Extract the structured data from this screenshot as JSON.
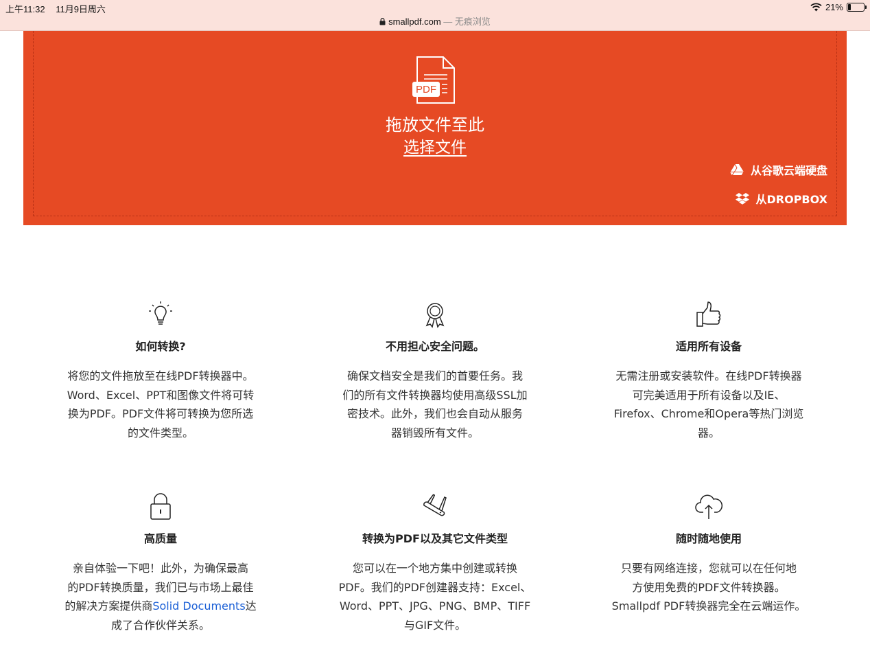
{
  "status_bar": {
    "time": "上午11:32",
    "date": "11月9日周六",
    "battery": "21%",
    "battery_level": 0.21
  },
  "url_bar": {
    "domain": "smallpdf.com",
    "separator": "—",
    "mode": "无痕浏览"
  },
  "dropzone": {
    "icon_label": "PDF",
    "drop_text": "拖放文件至此",
    "choose_label": "选择文件",
    "gdrive_label": "从谷歌云端硬盘",
    "dropbox_label": "从DROPBOX",
    "background_color": "#e64a24"
  },
  "features": [
    {
      "title": "如何转换?",
      "icon": "lightbulb-icon",
      "lines": [
        "将您的文件拖放至在线PDF转换器中。",
        "Word、Excel、PPT和图像文件将可转",
        "换为PDF。PDF文件将可转换为您所选",
        "的文件类型。"
      ]
    },
    {
      "title": "不用担心安全问题。",
      "icon": "award-icon",
      "lines": [
        "确保文档安全是我们的首要任务。我",
        "们的所有文件转换器均使用高级SSL加",
        "密技术。此外，我们也会自动从服务",
        "器销毁所有文件。"
      ]
    },
    {
      "title": "适用所有设备",
      "icon": "thumbs-up-icon",
      "lines": [
        "无需注册或安装软件。在线PDF转换器",
        "可完美适用于所有设备以及IE、",
        "Firefox、Chrome和Opera等热门浏览",
        "器。"
      ]
    },
    {
      "title": "高质量",
      "icon": "lock-icon",
      "line1": "亲自体验一下吧！此外，为确保最高",
      "line2": "的PDF转换质量，我们已与市场上最佳",
      "line3_prefix": "的解决方案提供商",
      "line3_link": "Solid Documents",
      "line3_suffix": "达",
      "line4": "成了合作伙伴关系。",
      "link_color": "#1a5fd6"
    },
    {
      "title": "转换为PDF以及其它文件类型",
      "icon": "swiss-knife-icon",
      "lines": [
        "您可以在一个地方集中创建或转换",
        "PDF。我们的PDF创建器支持：Excel、",
        "Word、PPT、JPG、PNG、BMP、TIFF",
        "与GIF文件。"
      ]
    },
    {
      "title": "随时随地使用",
      "icon": "cloud-upload-icon",
      "lines": [
        "只要有网络连接，您就可以在任何地",
        "方使用免费的PDF文件转换器。",
        "Smallpdf PDF转换器完全在云端运作。"
      ]
    }
  ]
}
